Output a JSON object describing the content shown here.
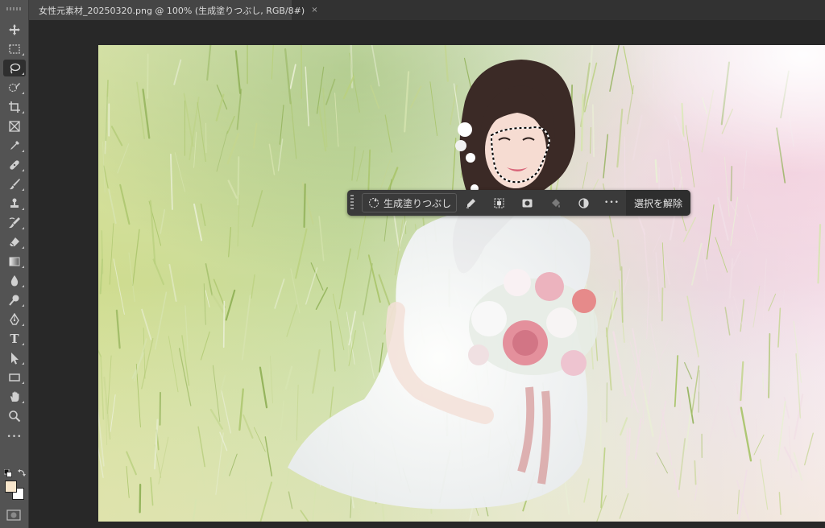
{
  "document": {
    "tab_title": "女性元素材_20250320.png @ 100% (生成塗りつぶし, RGB/8#)",
    "tab_close": "×"
  },
  "toolbar": {
    "tools": [
      {
        "name": "move-tool",
        "icon": "move-icon"
      },
      {
        "name": "rectangular-marquee-tool",
        "icon": "marquee-icon"
      },
      {
        "name": "lasso-tool",
        "icon": "lasso-icon",
        "active": true
      },
      {
        "name": "object-selection-tool",
        "icon": "object-selection-icon"
      },
      {
        "name": "crop-tool",
        "icon": "crop-icon"
      },
      {
        "name": "frame-tool",
        "icon": "frame-icon"
      },
      {
        "name": "eyedropper-tool",
        "icon": "eyedropper-icon"
      },
      {
        "name": "spot-healing-tool",
        "icon": "bandage-icon"
      },
      {
        "name": "brush-tool",
        "icon": "brush-icon"
      },
      {
        "name": "clone-stamp-tool",
        "icon": "stamp-icon"
      },
      {
        "name": "history-brush-tool",
        "icon": "history-brush-icon"
      },
      {
        "name": "eraser-tool",
        "icon": "eraser-icon"
      },
      {
        "name": "gradient-tool",
        "icon": "gradient-icon"
      },
      {
        "name": "blur-tool",
        "icon": "drop-icon"
      },
      {
        "name": "dodge-tool",
        "icon": "dodge-icon"
      },
      {
        "name": "pen-tool",
        "icon": "pen-icon"
      },
      {
        "name": "type-tool",
        "icon": "type-icon"
      },
      {
        "name": "path-selection-tool",
        "icon": "arrow-icon"
      },
      {
        "name": "rectangle-tool",
        "icon": "rectangle-icon"
      },
      {
        "name": "hand-tool",
        "icon": "hand-icon"
      },
      {
        "name": "zoom-tool",
        "icon": "zoom-icon"
      },
      {
        "name": "edit-toolbar",
        "icon": "more-icon"
      }
    ],
    "type_glyph": "T",
    "foreground_color": "#f8e6cc",
    "background_color": "#ffffff"
  },
  "taskbar": {
    "generative_fill_label": "生成塗りつぶし",
    "icons": [
      "modify-selection-icon",
      "invert-selection-icon",
      "mask-icon",
      "fill-icon",
      "adjustment-icon",
      "more-icon"
    ],
    "more_glyph": "•••",
    "deselect_label": "選択を解除"
  }
}
